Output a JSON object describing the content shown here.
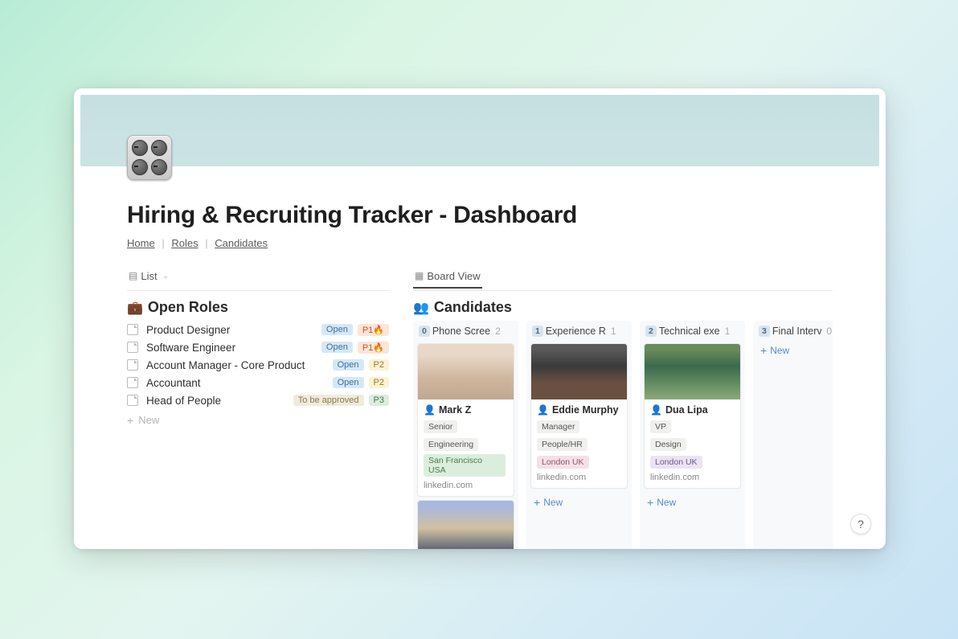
{
  "page": {
    "title": "Hiring & Recruiting Tracker - Dashboard"
  },
  "breadcrumbs": {
    "home": "Home",
    "roles": "Roles",
    "candidates": "Candidates"
  },
  "left_view": {
    "tab_label": "List",
    "section_title": "Open Roles",
    "section_emoji": "💼",
    "new_label": "New",
    "roles": [
      {
        "name": "Product Designer",
        "status": "Open",
        "status_kind": "open",
        "priority": "P1",
        "priority_class": "p1",
        "fire": true
      },
      {
        "name": "Software Engineer",
        "status": "Open",
        "status_kind": "open",
        "priority": "P1",
        "priority_class": "p1",
        "fire": true
      },
      {
        "name": "Account Manager - Core Product",
        "status": "Open",
        "status_kind": "open",
        "priority": "P2",
        "priority_class": "p2",
        "fire": false
      },
      {
        "name": "Accountant",
        "status": "Open",
        "status_kind": "open",
        "priority": "P2",
        "priority_class": "p2",
        "fire": false
      },
      {
        "name": "Head of People",
        "status": "To be approved",
        "status_kind": "approve",
        "priority": "P3",
        "priority_class": "p3",
        "fire": false
      }
    ]
  },
  "right_view": {
    "tab_label": "Board View",
    "section_title": "Candidates",
    "section_emoji": "👥",
    "new_label": "New",
    "columns": [
      {
        "stage_num": "0",
        "stage_name": "Phone Scree",
        "count": "2",
        "cards": [
          {
            "img_class": "img-a",
            "name": "Mark Z",
            "tags": [
              {
                "text": "Senior",
                "cls": ""
              },
              {
                "text": "Engineering",
                "cls": ""
              },
              {
                "text": "San Francisco USA",
                "cls": "green"
              }
            ],
            "link": "linkedin.com"
          },
          {
            "img_class": "img-d",
            "image_only": true
          }
        ],
        "show_new": false
      },
      {
        "stage_num": "1",
        "stage_name": "Experience R",
        "count": "1",
        "cards": [
          {
            "img_class": "img-b",
            "name": "Eddie Murphy",
            "tags": [
              {
                "text": "Manager",
                "cls": ""
              },
              {
                "text": "People/HR",
                "cls": ""
              },
              {
                "text": "London UK",
                "cls": "pink"
              }
            ],
            "link": "linkedin.com"
          }
        ],
        "show_new": true
      },
      {
        "stage_num": "2",
        "stage_name": "Technical exe",
        "count": "1",
        "cards": [
          {
            "img_class": "img-c",
            "name": "Dua Lipa",
            "tags": [
              {
                "text": "VP",
                "cls": ""
              },
              {
                "text": "Design",
                "cls": ""
              },
              {
                "text": "London UK",
                "cls": "purple"
              }
            ],
            "link": "linkedin.com"
          }
        ],
        "show_new": true
      },
      {
        "stage_num": "3",
        "stage_name": "Final Intervie",
        "count": "0",
        "cards": [],
        "show_new": true,
        "last": true
      }
    ]
  },
  "help": "?"
}
